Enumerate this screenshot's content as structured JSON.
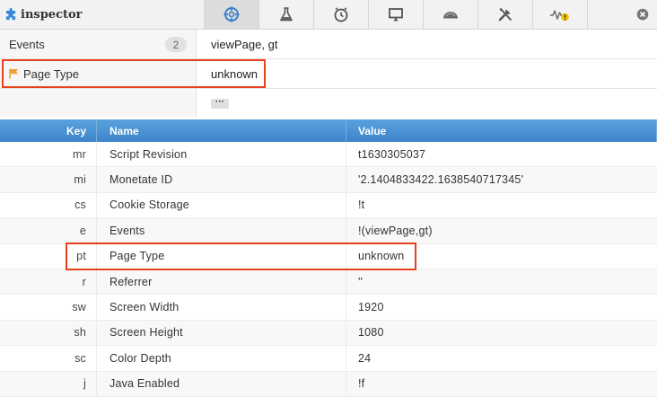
{
  "app": {
    "title": "inspector"
  },
  "toolbar": {
    "tabs": [
      {
        "icon": "crosshair-icon",
        "active": true
      },
      {
        "icon": "flask-icon",
        "active": false
      },
      {
        "icon": "clock-icon",
        "active": false
      },
      {
        "icon": "monitor-icon",
        "active": false
      },
      {
        "icon": "cloud-icon",
        "active": false
      },
      {
        "icon": "tools-icon",
        "active": false
      },
      {
        "icon": "pulse-warning-icon",
        "active": false
      }
    ],
    "close_icon": "close-icon"
  },
  "summary": {
    "events": {
      "label": "Events",
      "count": "2",
      "value": "viewPage, gt"
    },
    "page_type": {
      "label": "Page Type",
      "value": "unknown"
    },
    "more_label": "···"
  },
  "table": {
    "headers": {
      "key": "Key",
      "name": "Name",
      "value": "Value"
    },
    "rows": [
      {
        "key": "mr",
        "name": "Script Revision",
        "value": "t1630305037"
      },
      {
        "key": "mi",
        "name": "Monetate ID",
        "value": "'2.1404833422.1638540717345'"
      },
      {
        "key": "cs",
        "name": "Cookie Storage",
        "value": "!t"
      },
      {
        "key": "e",
        "name": "Events",
        "value": "!(viewPage,gt)"
      },
      {
        "key": "pt",
        "name": "Page Type",
        "value": "unknown"
      },
      {
        "key": "r",
        "name": "Referrer",
        "value": "''"
      },
      {
        "key": "sw",
        "name": "Screen Width",
        "value": "1920"
      },
      {
        "key": "sh",
        "name": "Screen Height",
        "value": "1080"
      },
      {
        "key": "sc",
        "name": "Color Depth",
        "value": "24"
      },
      {
        "key": "j",
        "name": "Java Enabled",
        "value": "!f"
      }
    ]
  },
  "colors": {
    "accent": "#3c84c8",
    "highlight": "#e8401b",
    "flag": "#f0a030",
    "logo": "#3a8ad8"
  }
}
